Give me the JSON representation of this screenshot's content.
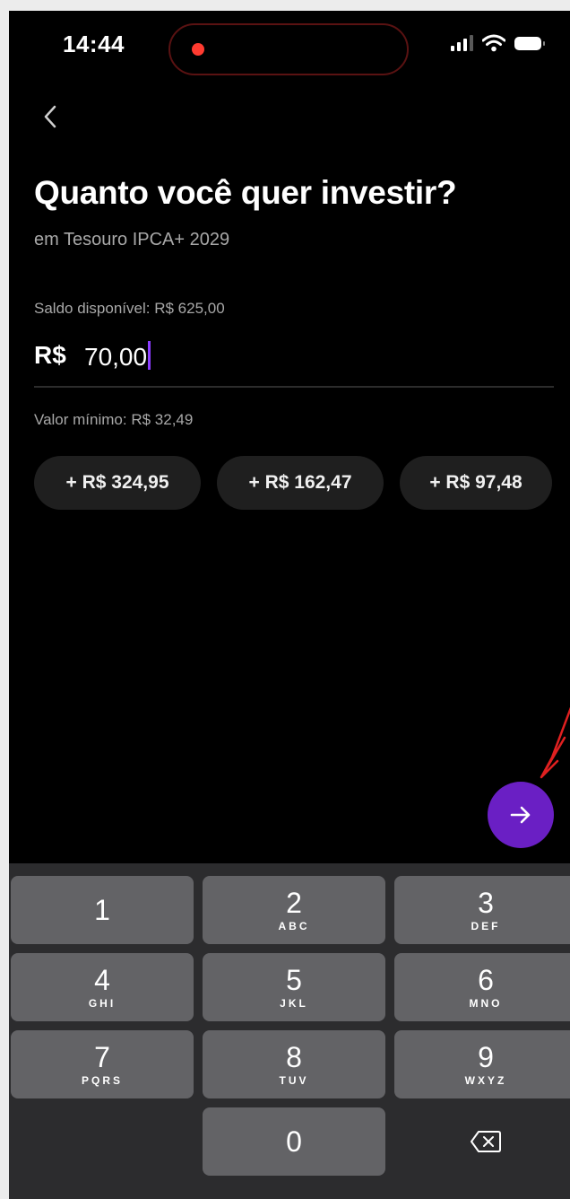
{
  "status_bar": {
    "time": "14:44"
  },
  "header": {
    "title": "Quanto você quer investir?",
    "subtitle": "em Tesouro IPCA+ 2029"
  },
  "balance_label": "Saldo disponível: R$ 625,00",
  "amount": {
    "prefix": "R$",
    "value": "70,00"
  },
  "minimum_label": "Valor mínimo: R$ 32,49",
  "quick_amounts": [
    "+ R$ 324,95",
    "+ R$ 162,47",
    "+ R$ 97,48"
  ],
  "keypad": {
    "keys": [
      {
        "num": "1",
        "letters": ""
      },
      {
        "num": "2",
        "letters": "ABC"
      },
      {
        "num": "3",
        "letters": "DEF"
      },
      {
        "num": "4",
        "letters": "GHI"
      },
      {
        "num": "5",
        "letters": "JKL"
      },
      {
        "num": "6",
        "letters": "MNO"
      },
      {
        "num": "7",
        "letters": "PQRS"
      },
      {
        "num": "8",
        "letters": "TUV"
      },
      {
        "num": "9",
        "letters": "WXYZ"
      },
      {
        "num": "0",
        "letters": ""
      }
    ]
  },
  "colors": {
    "accent": "#6a1fc4",
    "recording_dot": "#ff3b30",
    "annotation_arrow": "#e02020"
  },
  "icons": [
    "back-chevron-icon",
    "arrow-right-icon",
    "backspace-icon",
    "signal-icon",
    "wifi-icon",
    "battery-icon"
  ]
}
